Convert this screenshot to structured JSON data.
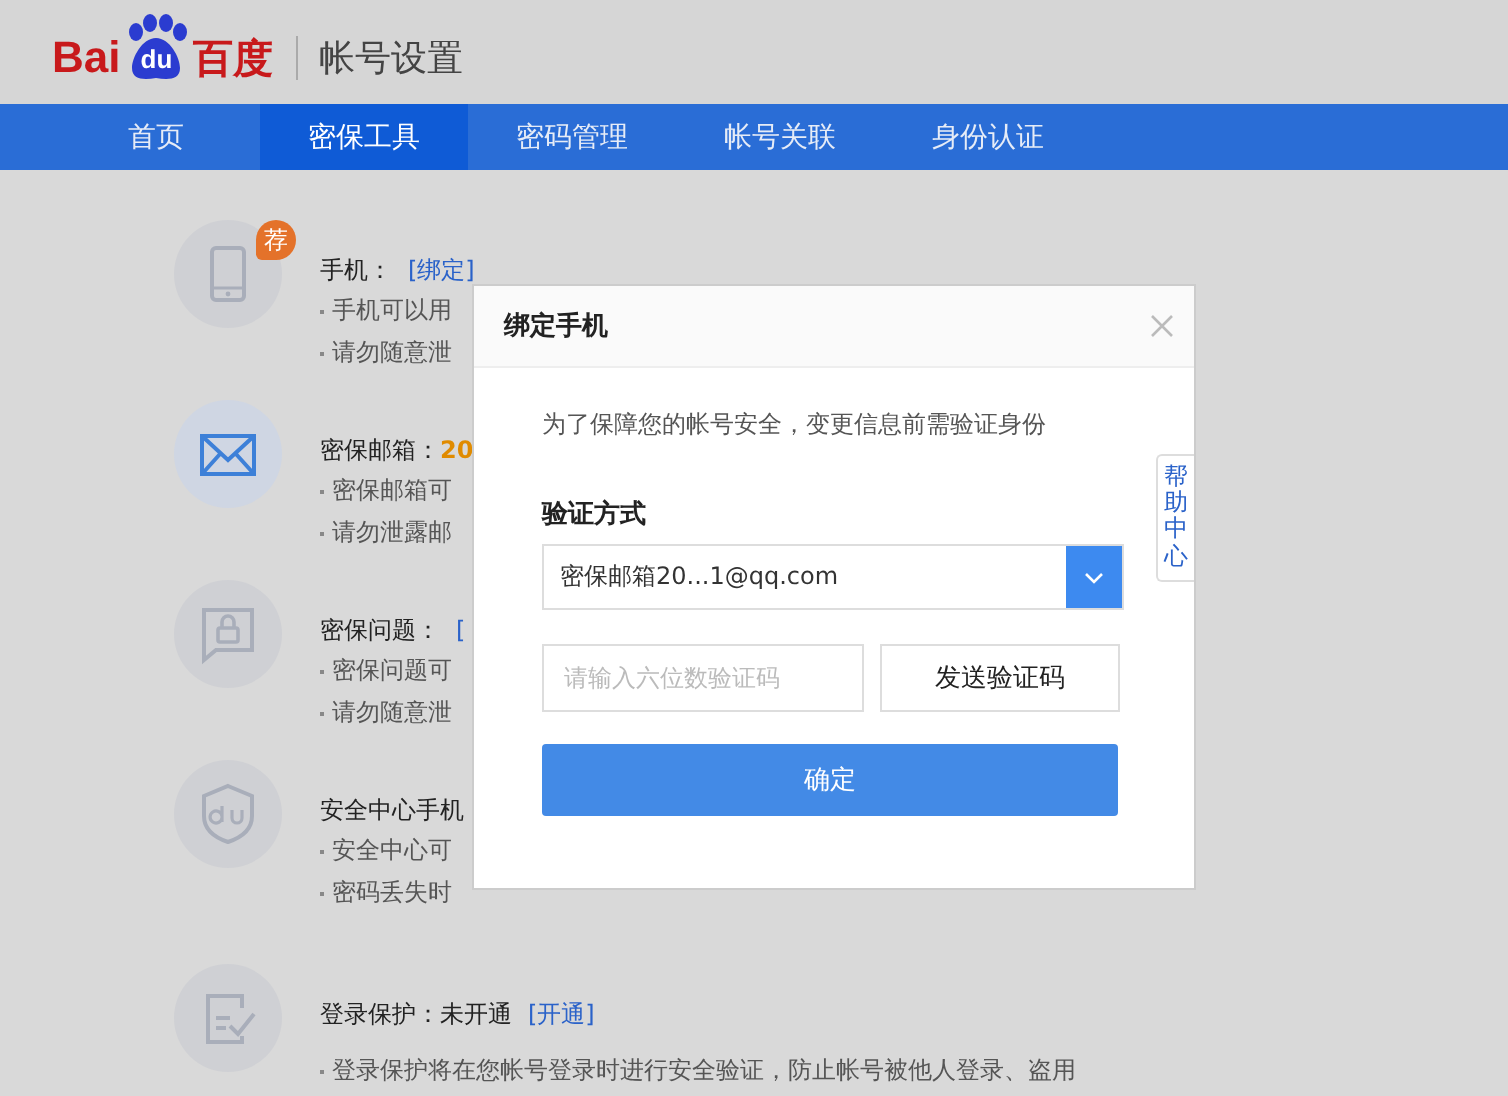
{
  "header": {
    "logo_left": "Bai",
    "logo_paw": "du",
    "logo_right": "百度",
    "title": "帐号设置"
  },
  "nav": [
    {
      "label": "首页",
      "selected": false
    },
    {
      "label": "密保工具",
      "selected": true
    },
    {
      "label": "密码管理",
      "selected": false
    },
    {
      "label": "帐号关联",
      "selected": false
    },
    {
      "label": "身份认证",
      "selected": false
    }
  ],
  "items": [
    {
      "kind": "phone",
      "active": false,
      "badge": "荐",
      "title": "手机：",
      "link": "[绑定]",
      "lines": [
        "手机可以用",
        "请勿随意泄"
      ]
    },
    {
      "kind": "mail",
      "active": true,
      "title": "密保邮箱：",
      "value": "20",
      "warning": true,
      "lines": [
        "密保邮箱可",
        "请勿泄露邮"
      ]
    },
    {
      "kind": "question",
      "active": false,
      "title": "密保问题：",
      "link": "[",
      "lines": [
        "密保问题可",
        "请勿随意泄"
      ]
    },
    {
      "kind": "shield",
      "active": false,
      "title": "安全中心手机",
      "lines": [
        "安全中心可",
        "密码丢失时"
      ]
    },
    {
      "kind": "check",
      "active": false,
      "title": "登录保护：",
      "value": "未开通",
      "warning": false,
      "link": "[开通]",
      "lines": [
        "登录保护将在您帐号登录时进行安全验证，防止帐号被他人登录、盗用"
      ]
    }
  ],
  "dialog": {
    "title": "绑定手机",
    "intro": "为了保障您的帐号安全，变更信息前需验证身份",
    "method_label": "验证方式",
    "method_value": "密保邮箱20...1@qq.com",
    "code_placeholder": "请输入六位数验证码",
    "send_button": "发送验证码",
    "confirm_button": "确定"
  },
  "help_tab": "帮助中心"
}
